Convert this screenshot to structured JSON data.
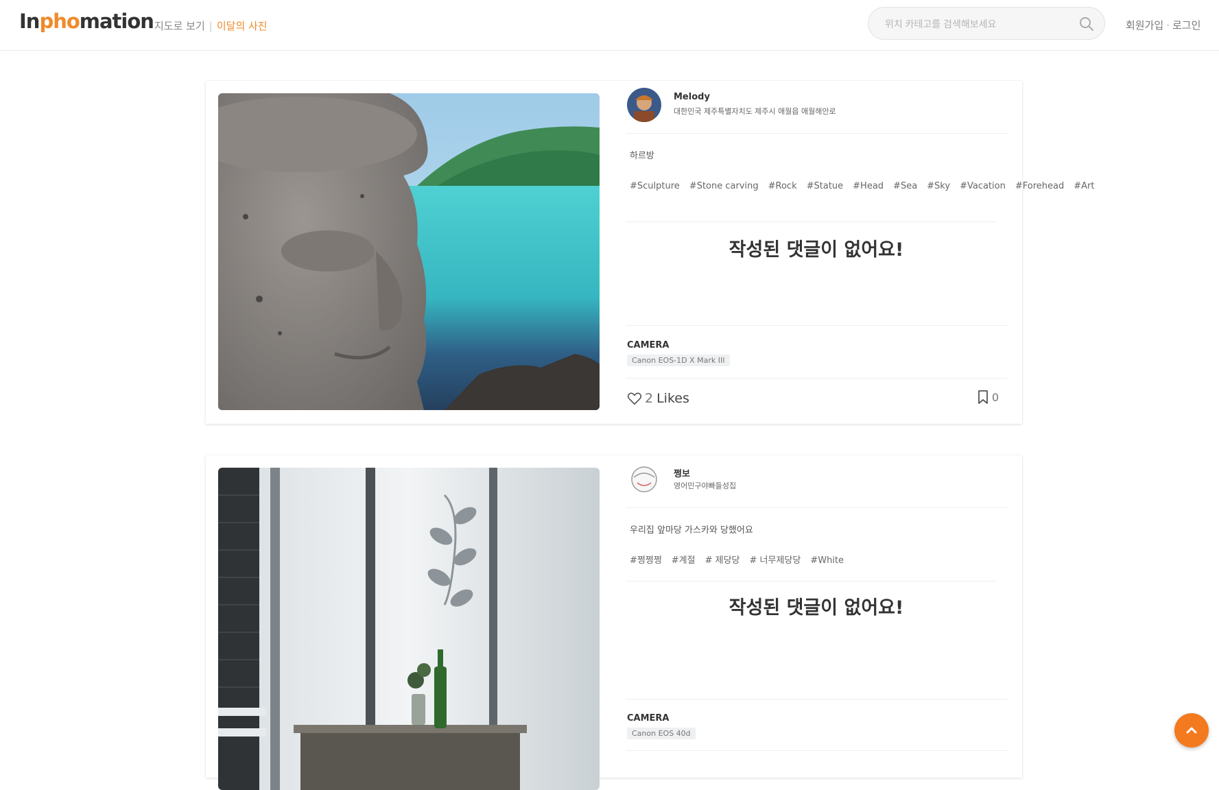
{
  "header": {
    "logo": {
      "part1": "In",
      "part2": "pho",
      "part3": "mation"
    },
    "nav": [
      {
        "label": "지도로 보기"
      },
      {
        "label": "이달의 사진"
      }
    ],
    "search": {
      "placeholder": "위치 카테고를 검색해보세요",
      "value": ""
    },
    "auth": {
      "signup": "회원가입",
      "login": "로그인"
    }
  },
  "posts": [
    {
      "username": "Melody",
      "location": "대한민국 제주특별자치도 제주시 애월읍 애월해안로",
      "caption": "하르방",
      "tags": [
        "#Sculpture",
        "#Stone carving",
        "#Rock",
        "#Statue",
        "#Head",
        "#Sea",
        "#Sky",
        "#Vacation",
        "#Forehead",
        "#Art"
      ],
      "no_comment": "작성된 댓글이 없어요!",
      "camera_label": "CAMERA",
      "camera_model": "Canon EOS-1D X Mark III",
      "likes_count": "2",
      "likes_label": "Likes",
      "bookmarks": "0"
    },
    {
      "username": "쩡보",
      "location": "영어민구야빠들성집",
      "caption": "우리집 앞마당 가스카와 당했어요",
      "tags": [
        "#쩡쩡쩡",
        "#계절",
        "# 제당당",
        "# 너무제당당",
        "#White"
      ],
      "no_comment": "작성된 댓글이 없어요!",
      "camera_label": "CAMERA",
      "camera_model": "Canon EOS 40d"
    }
  ],
  "colors": {
    "accent": "#f08a2a",
    "scroll_button": "#f47a1f"
  },
  "icons": {
    "search": "search-icon",
    "heart": "heart-icon",
    "bookmark": "bookmark-icon",
    "scroll_top": "chevron-up-icon"
  }
}
